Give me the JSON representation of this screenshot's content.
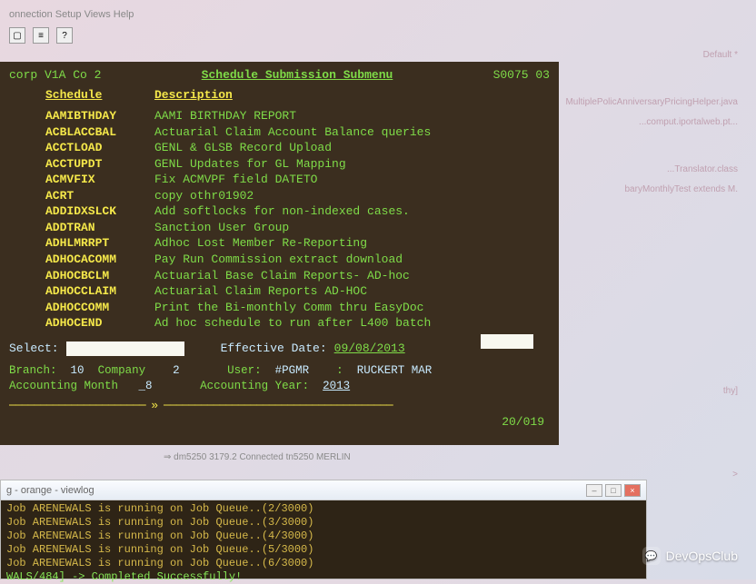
{
  "menubar": "onnection Setup Views Help",
  "topright": {
    "default": "Default *",
    "line1": "MultiplePolicAnniversaryPricingHelper.java",
    "line2": "...comput.iportalweb.pt...",
    "line3": "...Translator.class",
    "line4": "baryMonthlyTest extends M.",
    "line5": "thy]",
    "line6": ">"
  },
  "terminal": {
    "left_head": "corp V1A Co 2",
    "title": "Schedule Submission Submenu",
    "right_head": "S0075 03",
    "columns": {
      "schedule": "Schedule",
      "description": "Description"
    },
    "rows": [
      {
        "sched": "AAMIBTHDAY",
        "desc": "AAMI BIRTHDAY REPORT"
      },
      {
        "sched": "ACBLACCBAL",
        "desc": "Actuarial Claim Account Balance queries"
      },
      {
        "sched": "ACCTLOAD",
        "desc": "GENL & GLSB Record Upload"
      },
      {
        "sched": "ACCTUPDT",
        "desc": "GENL Updates for GL Mapping"
      },
      {
        "sched": "ACMVFIX",
        "desc": "Fix ACMVPF field DATETO"
      },
      {
        "sched": "ACRT",
        "desc": "copy othr01902"
      },
      {
        "sched": "ADDIDXSLCK",
        "desc": "Add softlocks for non-indexed cases."
      },
      {
        "sched": "ADDTRAN",
        "desc": "Sanction User Group"
      },
      {
        "sched": "ADHLMRRPT",
        "desc": "Adhoc Lost Member Re-Reporting"
      },
      {
        "sched": "ADHOCACOMM",
        "desc": "Pay Run Commission extract download"
      },
      {
        "sched": "ADHOCBCLM",
        "desc": "Actuarial Base Claim Reports- AD-hoc"
      },
      {
        "sched": "ADHOCCLAIM",
        "desc": "Actuarial Claim Reports AD-HOC"
      },
      {
        "sched": "ADHOCCOMM",
        "desc": "Print the Bi-monthly Comm thru EasyDoc"
      },
      {
        "sched": "ADHOCEND",
        "desc": "Ad hoc schedule to run after L400 batch"
      }
    ],
    "select_label": "Select:",
    "effective_label": "Effective Date:",
    "effective_value": "09/08/2013",
    "branch_label": "Branch:",
    "branch_value": "10",
    "company_label": "Company",
    "company_value": "2",
    "user_label": "User:",
    "user_value": "#PGMR",
    "user_name": "RUCKERT MAR",
    "acctmonth_label": "Accounting Month",
    "acctmonth_value": "_8",
    "acctyear_label": "Accounting Year:",
    "acctyear_value": "2013",
    "cursor": "20/019"
  },
  "statusbar": "⇒     dm5250  3179.2  Connected            tn5250  MERLIN",
  "logwin": {
    "title": "g - orange - viewlog",
    "lines": [
      "Job ARENEWALS is running on Job Queue..(2/3000)",
      "Job ARENEWALS is running on Job Queue..(3/3000)",
      "Job ARENEWALS is running on Job Queue..(4/3000)",
      "Job ARENEWALS is running on Job Queue..(5/3000)",
      "Job ARENEWALS is running on Job Queue..(6/3000)"
    ],
    "success": "WALS/484] -> Completed Successfully!"
  },
  "watermark": "DevOpsClub"
}
